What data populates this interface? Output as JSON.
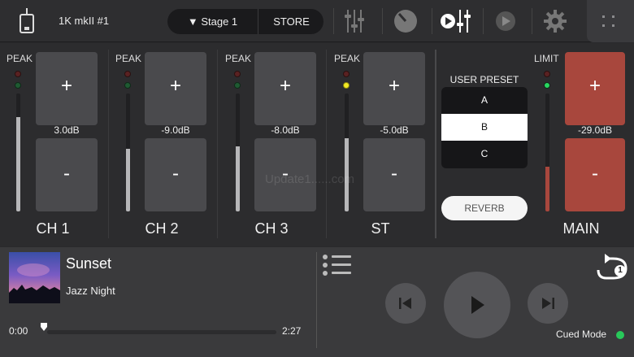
{
  "header": {
    "device_name": "1K mkII #1",
    "scene_label": "▼ Stage 1",
    "store_label": "STORE",
    "icons": [
      "device-icon",
      "mixer-sliders-icon",
      "knob-icon",
      "play-sliders-icon",
      "play-circle-icon",
      "gear-icon",
      "grid-menu-icon"
    ]
  },
  "channels": [
    {
      "indicator": "PEAK",
      "gain": "3.0dB",
      "name": "CH 1",
      "plus": "+",
      "minus": "-",
      "level": 0.8,
      "led": "off"
    },
    {
      "indicator": "PEAK",
      "gain": "-9.0dB",
      "name": "CH 2",
      "plus": "+",
      "minus": "-",
      "level": 0.53,
      "led": "off"
    },
    {
      "indicator": "PEAK",
      "gain": "-8.0dB",
      "name": "CH 3",
      "plus": "+",
      "minus": "-",
      "level": 0.55,
      "led": "off"
    },
    {
      "indicator": "PEAK",
      "gain": "-5.0dB",
      "name": "ST",
      "plus": "+",
      "minus": "-",
      "level": 0.62,
      "led": "yellow"
    }
  ],
  "main": {
    "indicator": "LIMIT",
    "gain": "-29.0dB",
    "name": "MAIN",
    "plus": "+",
    "minus": "-",
    "level": 0.38,
    "led": "green"
  },
  "preset": {
    "title": "USER PRESET",
    "items": [
      "A",
      "B",
      "C"
    ],
    "selected": "B",
    "reverb_label": "REVERB"
  },
  "player": {
    "title": "Sunset",
    "artist": "Jazz Night",
    "time_start": "0:00",
    "time_end": "2:27",
    "progress": 0.0,
    "cued_label": "Cued Mode",
    "repeat_count": "1"
  },
  "watermark": "Update1......com",
  "colors": {
    "main_button": "#a8473d",
    "cued_dot": "#28c85a",
    "led_yellow": "#f2ea25"
  }
}
